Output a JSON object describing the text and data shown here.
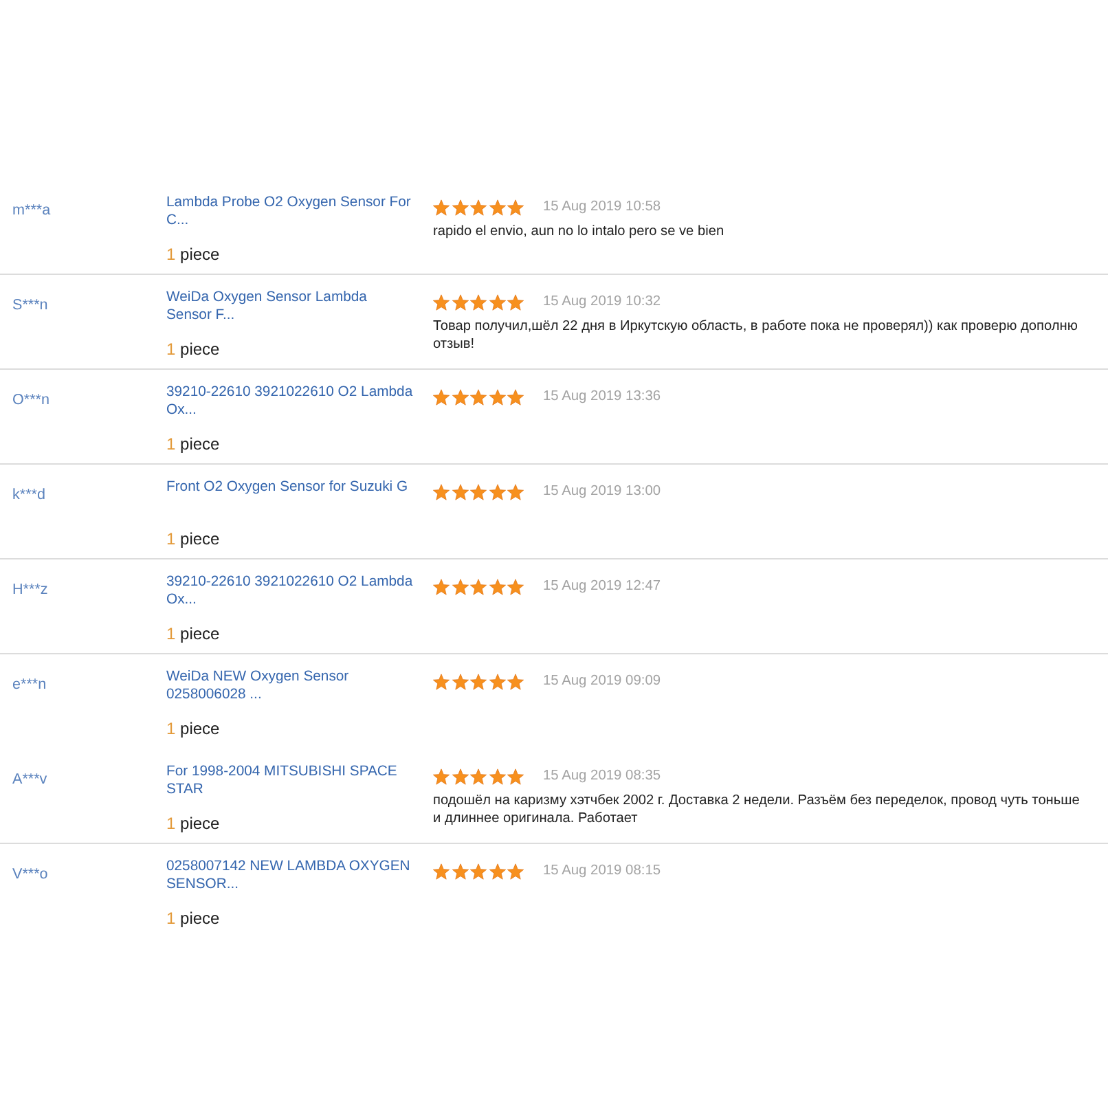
{
  "reviews": [
    {
      "user": "m***a",
      "product": "Lambda Probe O2 Oxygen Sensor For C...",
      "quantity": "1",
      "unit": "piece",
      "stars": 5,
      "date": "15 Aug 2019 10:58",
      "text": "rapido el envio, aun no lo intalo pero se ve bien",
      "divider": true
    },
    {
      "user": "S***n",
      "product": "WeiDa Oxygen Sensor Lambda Sensor F...",
      "quantity": "1",
      "unit": "piece",
      "stars": 5,
      "date": "15 Aug 2019 10:32",
      "text": "Товар получил,шёл 22 дня в Иркутскую область, в работе пока не проверял)) как проверю дополню отзыв!",
      "divider": true
    },
    {
      "user": "O***n",
      "product": "39210-22610 3921022610 O2 Lambda Ox...",
      "quantity": "1",
      "unit": "piece",
      "stars": 5,
      "date": "15 Aug 2019 13:36",
      "divider": true
    },
    {
      "user": "k***d",
      "product": "Front O2 Oxygen Sensor for Suzuki G",
      "quantity": "1",
      "unit": "piece",
      "stars": 5,
      "date": "15 Aug 2019 13:00",
      "divider": true
    },
    {
      "user": "H***z",
      "product": "39210-22610 3921022610 O2 Lambda Ox...",
      "quantity": "1",
      "unit": "piece",
      "stars": 5,
      "date": "15 Aug 2019 12:47",
      "divider": true
    },
    {
      "user": "e***n",
      "product": "WeiDa NEW Oxygen Sensor 0258006028 ...",
      "quantity": "1",
      "unit": "piece",
      "stars": 5,
      "date": "15 Aug 2019 09:09",
      "divider": false
    },
    {
      "user": "A***v",
      "product": "For 1998-2004 MITSUBISHI SPACE STAR",
      "quantity": "1",
      "unit": "piece",
      "stars": 5,
      "date": "15 Aug 2019 08:35",
      "text": "подошёл на каризму хэтчбек 2002 г. Доставка 2 недели. Разъём без переделок, провод чуть тоньше и длиннее оригинала. Работает",
      "divider": true
    },
    {
      "user": "V***o",
      "product": "0258007142 NEW LAMBDA OXYGEN SENSOR...",
      "quantity": "1",
      "unit": "piece",
      "stars": 5,
      "date": "15 Aug 2019 08:15",
      "divider": false
    }
  ]
}
